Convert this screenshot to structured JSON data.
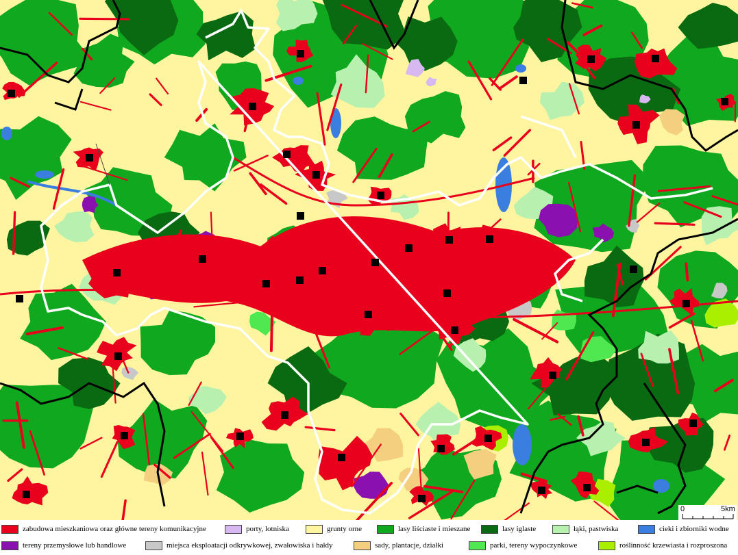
{
  "scale": {
    "start_label": "0",
    "end_label": "5km"
  },
  "colors": {
    "residential": "#e8001c",
    "airport": "#d8b8f0",
    "arable": "#fff5a0",
    "deciduous_forest": "#10a81e",
    "coniferous_forest": "#0a6a12",
    "meadows": "#b8f0b0",
    "water": "#3a7fe0",
    "industrial": "#8a10b0",
    "mining": "#c8c8c8",
    "orchards": "#f5cf80",
    "parks": "#50e850",
    "shrubs": "#aaee00",
    "boundary_black": "#000000",
    "boundary_white": "#ffffff",
    "town_marker": "#000000"
  },
  "legend": [
    {
      "label": "zabudowa mieszkaniowa oraz główne tereny komunikacyjne",
      "color": "#e8001c"
    },
    {
      "label": "porty, lotniska",
      "color": "#d8b8f0"
    },
    {
      "label": "grunty orne",
      "color": "#fff5a0"
    },
    {
      "label": "lasy liściaste i mieszane",
      "color": "#10a81e"
    },
    {
      "label": "lasy iglaste",
      "color": "#0a6a12"
    },
    {
      "label": "łąki, pastwiska",
      "color": "#b8f0b0"
    },
    {
      "label": "cieki i zbiorniki wodne",
      "color": "#3a7fe0"
    },
    {
      "label": "tereny przemysłowe lub handlowe",
      "color": "#8a10b0"
    },
    {
      "label": "miejsca eksploatacji odkrywkowej, zwałowiska i hałdy",
      "color": "#c8c8c8"
    },
    {
      "label": "sady, plantacje, działki",
      "color": "#f5cf80"
    },
    {
      "label": "parki, tereny wypoczynkowe",
      "color": "#50e850"
    },
    {
      "label": "roślinność krzewiasta i rozproszona",
      "color": "#aaee00"
    }
  ]
}
